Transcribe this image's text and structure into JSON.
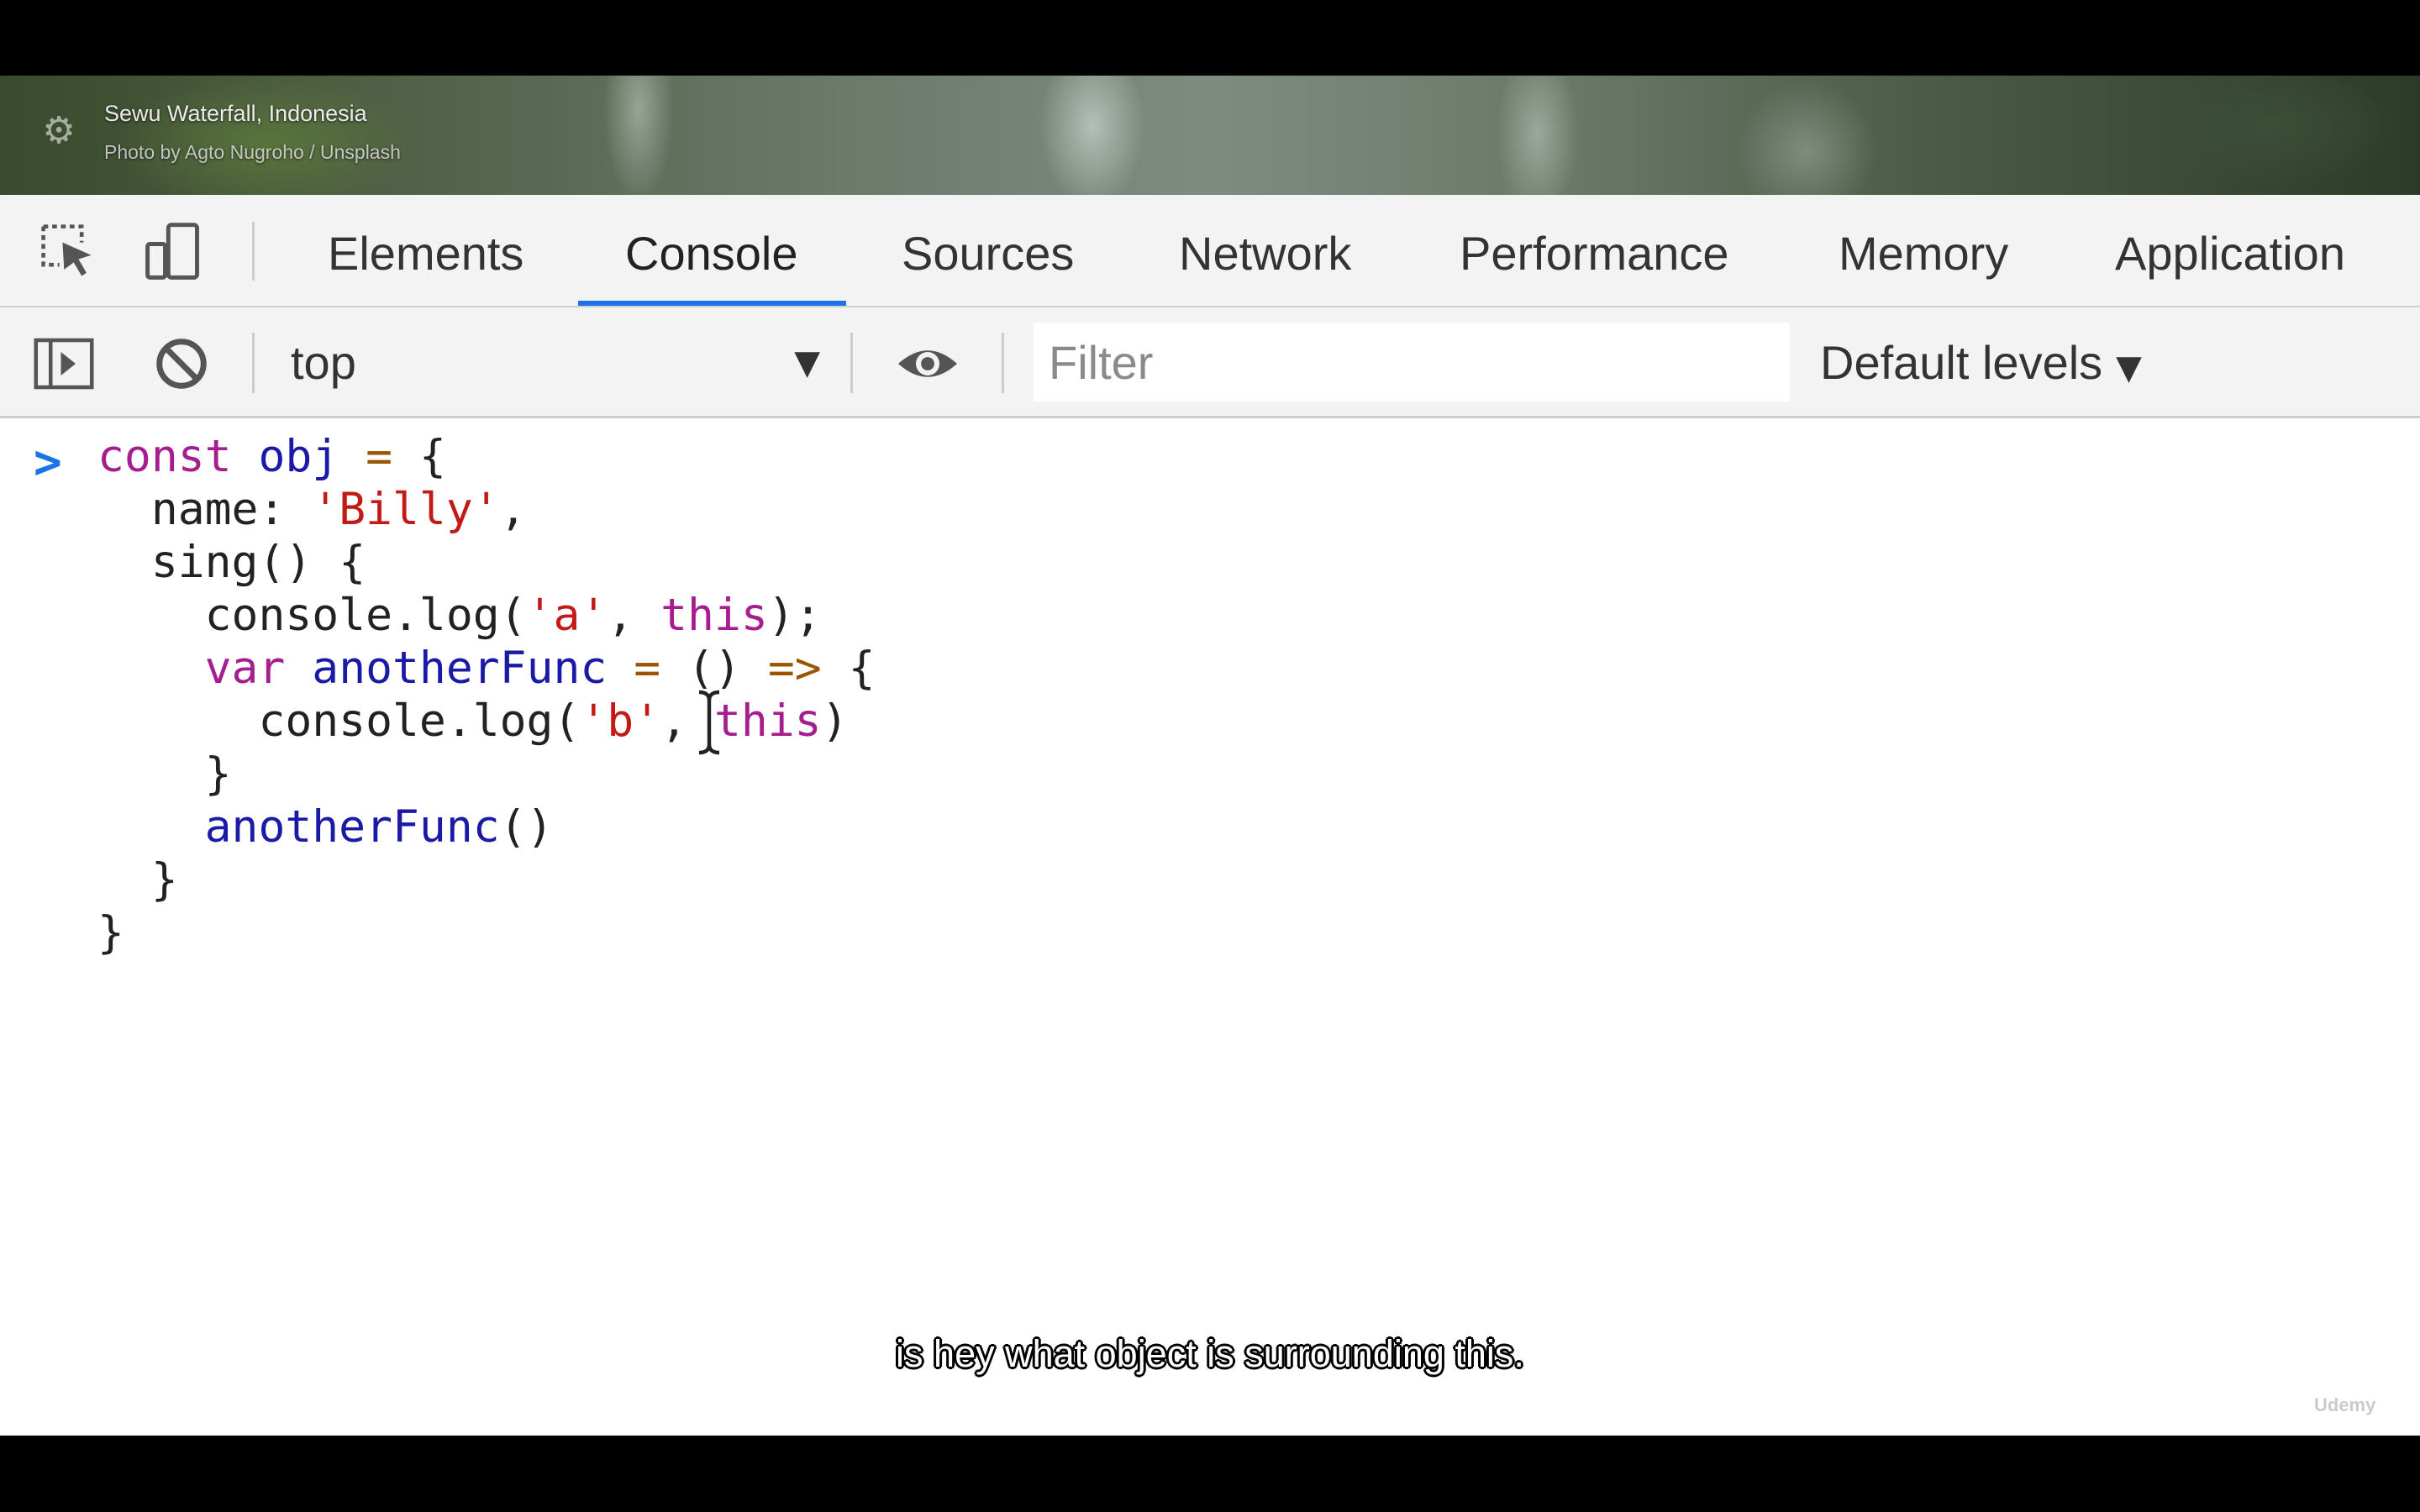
{
  "photo": {
    "title": "Sewu Waterfall, Indonesia",
    "credit": "Photo by Agto Nugroho / Unsplash"
  },
  "devtools": {
    "tabs": [
      {
        "label": "Elements",
        "active": false
      },
      {
        "label": "Console",
        "active": true
      },
      {
        "label": "Sources",
        "active": false
      },
      {
        "label": "Network",
        "active": false
      },
      {
        "label": "Performance",
        "active": false
      },
      {
        "label": "Memory",
        "active": false
      },
      {
        "label": "Application",
        "active": false
      }
    ],
    "accent_color": "#1a73e8",
    "icons": {
      "inspect": "inspect-element-icon",
      "device": "device-toolbar-icon",
      "sidebar": "show-sidebar-icon",
      "clear": "clear-console-icon",
      "live_expression": "eye-icon"
    }
  },
  "console": {
    "context": "top",
    "filter_placeholder": "Filter",
    "levels_label": "Default levels",
    "prompt": ">",
    "code": {
      "l1": [
        "const",
        "obj",
        "=",
        "{"
      ],
      "l2": [
        "name:",
        "'Billy'",
        ","
      ],
      "l3": [
        "sing()",
        "{"
      ],
      "l4": [
        "console.log(",
        "'a'",
        ",",
        "this",
        ");"
      ],
      "l5": [
        "var",
        "anotherFunc",
        "=",
        "()",
        "=>",
        "{"
      ],
      "l6": [
        "console.log(",
        "'b'",
        ",",
        "this",
        ")"
      ],
      "l7": [
        "}"
      ],
      "l8": [
        "anotherFunc",
        "()"
      ],
      "l9": [
        "}"
      ],
      "l10": [
        "}"
      ]
    }
  },
  "caption": "is hey what object is surrounding this.",
  "watermark": "Udemy"
}
